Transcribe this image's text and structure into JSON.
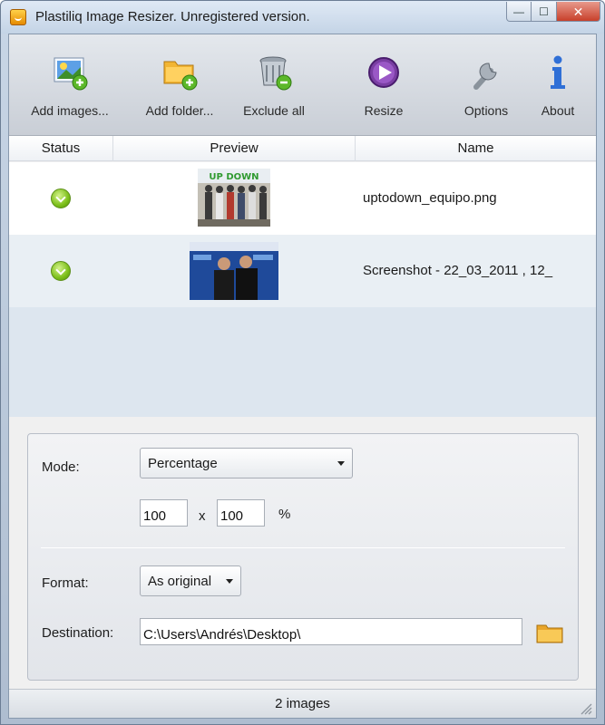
{
  "window": {
    "title": "Plastiliq Image Resizer. Unregistered version.",
    "controls": {
      "minimize": "—",
      "maximize": "☐",
      "close": "✕"
    }
  },
  "toolbar": {
    "items": [
      {
        "label": "Add images...",
        "icon": "add-images-icon"
      },
      {
        "label": "Add folder...",
        "icon": "add-folder-icon"
      },
      {
        "label": "Exclude all",
        "icon": "trash-icon"
      },
      {
        "label": "Resize",
        "icon": "play-icon"
      },
      {
        "label": "Options",
        "icon": "wrench-icon"
      },
      {
        "label": "About",
        "icon": "info-icon"
      }
    ]
  },
  "list": {
    "columns": [
      "Status",
      "Preview",
      "Name"
    ],
    "rows": [
      {
        "status": "ok",
        "thumbnail_text": "UP DOWN",
        "name": "uptodown_equipo.png"
      },
      {
        "status": "ok",
        "thumbnail_text": "",
        "name": "Screenshot - 22_03_2011 , 12_"
      }
    ]
  },
  "settings": {
    "mode_label": "Mode:",
    "mode_value": "Percentage",
    "width_value": "100",
    "times": "x",
    "height_value": "100",
    "unit": "%",
    "format_label": "Format:",
    "format_value": "As original",
    "destination_label": "Destination:",
    "destination_value": "C:\\Users\\Andrés\\Desktop\\"
  },
  "statusbar": {
    "text": "2 images"
  },
  "colors": {
    "accent_green": "#7cbf1a",
    "resize_purple": "#7a3ea3",
    "folder_yellow": "#f2b533"
  }
}
